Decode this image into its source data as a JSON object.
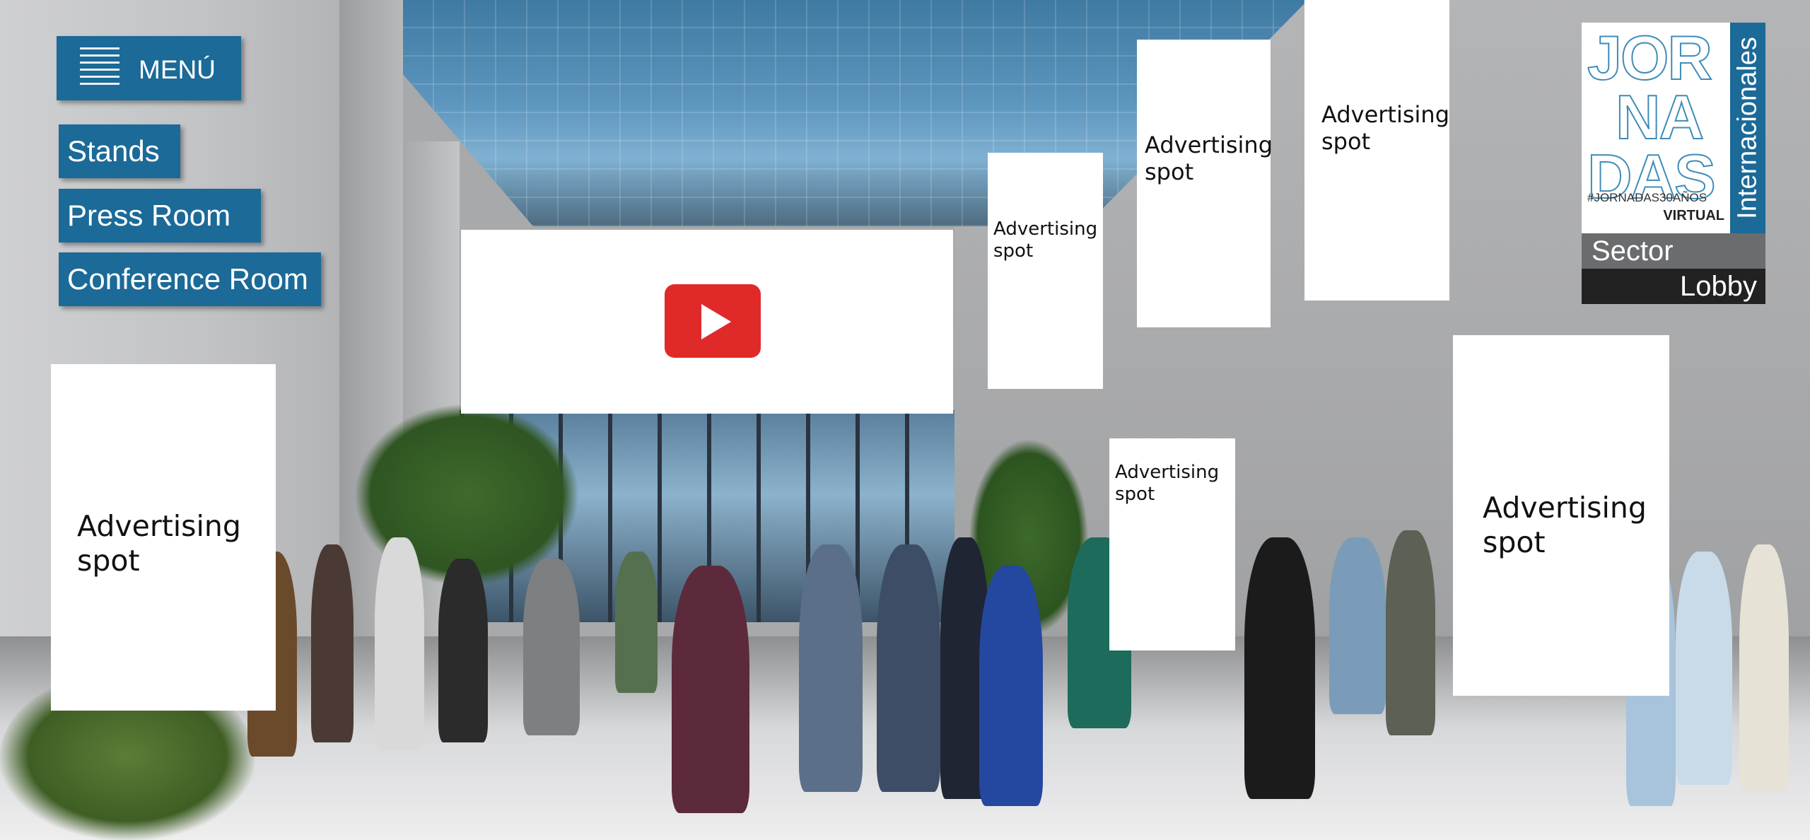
{
  "menu": {
    "label": "MENÚ",
    "icon": "hamburger-icon"
  },
  "nav": {
    "stands": "Stands",
    "press_room": "Press Room",
    "conference_room": "Conference Room"
  },
  "video": {
    "icon": "youtube-play-icon",
    "color": "#e02a2a"
  },
  "ads": {
    "label": "Advertising spot",
    "left_large": "Advertising spot",
    "small_center": "Advertising spot",
    "tall_center": "Advertising spot",
    "top_right": "Advertising spot",
    "mid_small": "Advertising spot",
    "right_large": "Advertising spot"
  },
  "logo": {
    "line1": "JOR",
    "line2": "NA",
    "line3": "DAS",
    "hashtag": "#JORNADAS30AÑOS",
    "virtual": "VIRTUAL",
    "vertical": "Internacionales",
    "sector": "Sector",
    "lobby": "Lobby"
  },
  "colors": {
    "brand_blue": "#1b6a98",
    "ad_background": "#ffffff"
  }
}
